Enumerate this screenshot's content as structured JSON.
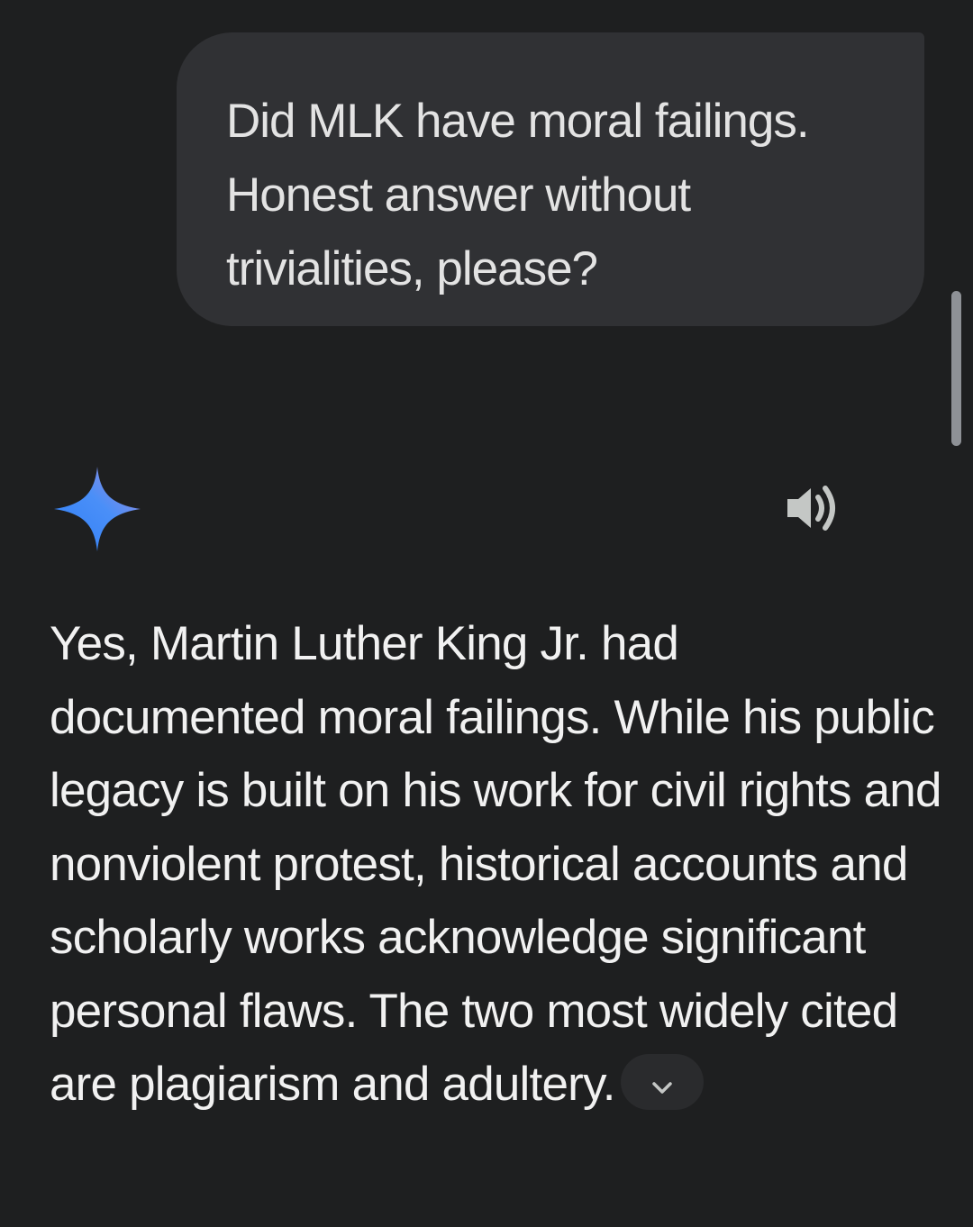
{
  "user_message": {
    "text": "Did MLK have moral failings.\nHonest answer without\ntrivialities, please?"
  },
  "response": {
    "text": "Yes, Martin Luther King Jr. had documented moral failings. While his public legacy is built on his work for civil rights and nonviolent protest, historical accounts and scholarly works acknowledge significant personal flaws. The two most widely cited are plagiarism and adultery."
  },
  "icons": {
    "assistant": "gemini-sparkle-icon",
    "speaker": "speaker-icon",
    "expand": "chevron-down-icon"
  },
  "colors": {
    "background": "#1e1f20",
    "bubble": "#303134",
    "text": "#e3e3e3",
    "sparkle_start": "#4285f4",
    "sparkle_end": "#9b72cb"
  }
}
